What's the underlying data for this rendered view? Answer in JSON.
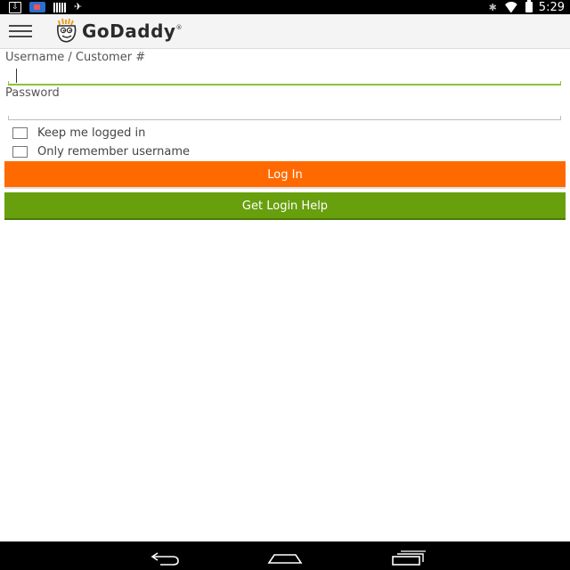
{
  "status_bar": {
    "time": "5:29",
    "left_icons": [
      "download-icon",
      "photo-icon",
      "barcode-icon",
      "airplane-icon"
    ],
    "right_icons": [
      "bluetooth-icon",
      "wifi-icon",
      "battery-icon"
    ]
  },
  "app_bar": {
    "menu_icon": "hamburger-menu-icon",
    "logo_text": "GoDaddy",
    "logo_trademark": "®"
  },
  "form": {
    "username": {
      "label": "Username / Customer #",
      "value": "",
      "placeholder": ""
    },
    "password": {
      "label": "Password",
      "value": "",
      "placeholder": ""
    },
    "keep_logged_in": {
      "label": "Keep me logged in",
      "checked": false
    },
    "remember_username": {
      "label": "Only remember username",
      "checked": false
    }
  },
  "buttons": {
    "login": "Log In",
    "help": "Get Login Help"
  },
  "colors": {
    "login_button": "#ff6a00",
    "help_button": "#689f0d",
    "focus_underline": "#8ac43a",
    "status_bar": "#000000"
  },
  "nav_bar": {
    "icons": [
      "back-icon",
      "home-icon",
      "recent-apps-icon"
    ]
  }
}
